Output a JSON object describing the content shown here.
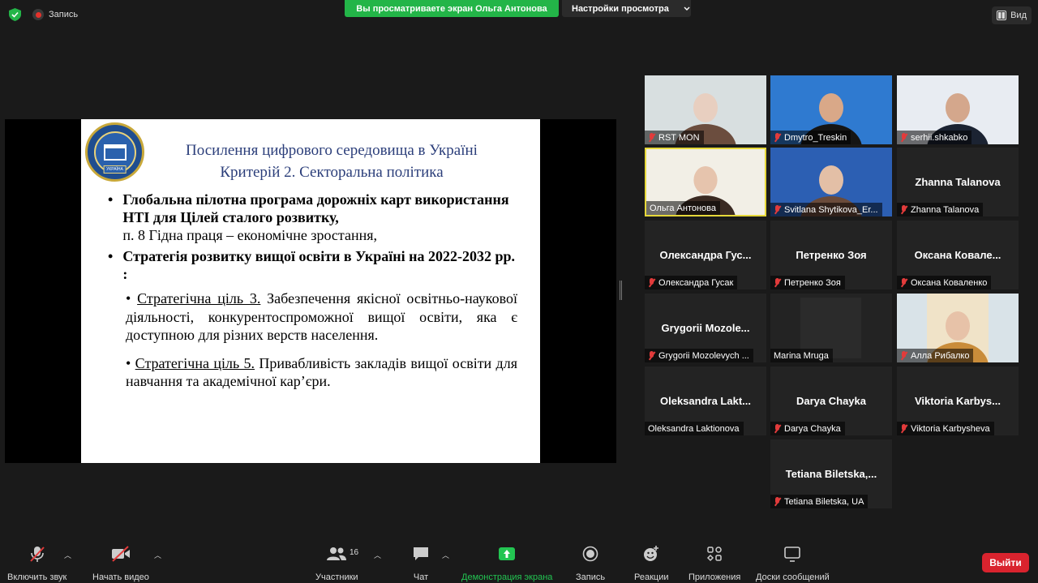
{
  "topbar": {
    "record_label": "Запись",
    "share_banner": "Вы просматриваете экран Ольга Антонова",
    "view_settings": "Настройки просмотра",
    "view_label": "Вид"
  },
  "slide": {
    "title_line1": "Посилення цифрового середовища в Україні",
    "title_line2": "Критерій 2. Секторальна політика",
    "logo_text": "УКРАЇНА",
    "bullet1_bold": "Глобальна пілотна програма дорожніх карт використання НТІ для Цілей сталого розвитку,",
    "bullet1_rest": "п. 8 Гідна праця – економічне зростання,",
    "bullet2_bold": "Стратегія розвитку вищої освіти в Україні на 2022-2032 рр. :",
    "sub1_label": "Стратегічна ціль 3.",
    "sub1_text": "Забезпечення якісної освітньо-наукової діяльності, конкурентоспроможної вищої освіти, яка є доступною для різних верств населення.",
    "sub2_label": "Стратегічна ціль 5.",
    "sub2_text": "Привабливість закладів вищої освіти для навчання та академічної кар’єри."
  },
  "participants": [
    {
      "name": "RST MON",
      "muted": true,
      "video": true
    },
    {
      "name": "Dmytro_Treskin",
      "muted": true,
      "video": true
    },
    {
      "name": "serhii.shkabko",
      "muted": true,
      "video": true
    },
    {
      "name": "Ольга Антонова",
      "muted": false,
      "video": true,
      "active": true
    },
    {
      "name": "Svitlana Shytikova_Er...",
      "muted": true,
      "video": true
    },
    {
      "name": "Zhanna Talanova",
      "display": "Zhanna Talanova",
      "muted": true,
      "video": false
    },
    {
      "name": "Олександра Гусак",
      "display": "Олександра Гус...",
      "muted": true,
      "video": false
    },
    {
      "name": "Петренко Зоя",
      "display": "Петренко Зоя",
      "muted": true,
      "video": false
    },
    {
      "name": "Оксана Коваленко",
      "display": "Оксана Ковале...",
      "muted": true,
      "video": false
    },
    {
      "name": "Grygorii Mozolevych ...",
      "display": "Grygorii Mozole...",
      "muted": true,
      "video": false
    },
    {
      "name": "Marina Mruga",
      "muted": false,
      "video": true
    },
    {
      "name": "Алла Рибалко",
      "muted": true,
      "video": true
    },
    {
      "name": "Oleksandra Laktionova",
      "display": "Oleksandra Lakt...",
      "muted": false,
      "video": false
    },
    {
      "name": "Darya Chayka",
      "display": "Darya Chayka",
      "muted": true,
      "video": false
    },
    {
      "name": "Viktoria Karbysheva",
      "display": "Viktoria Karbys...",
      "muted": true,
      "video": false
    },
    {
      "name": "Tetiana Biletska, UA",
      "display": "Tetiana Biletska,...",
      "muted": true,
      "video": false
    }
  ],
  "toolbar": {
    "audio": "Включить звук",
    "video": "Начать видео",
    "participants": "Участники",
    "participants_count": "16",
    "chat": "Чат",
    "share": "Демонстрация экрана",
    "record": "Запись",
    "reactions": "Реакции",
    "apps": "Приложения",
    "whiteboard": "Доски сообщений",
    "leave": "Выйти"
  },
  "colors": {
    "share_green": "#23b548",
    "leave_red": "#d9232e",
    "active_speaker": "#e6d83a",
    "slide_title": "#2b3e7a"
  }
}
